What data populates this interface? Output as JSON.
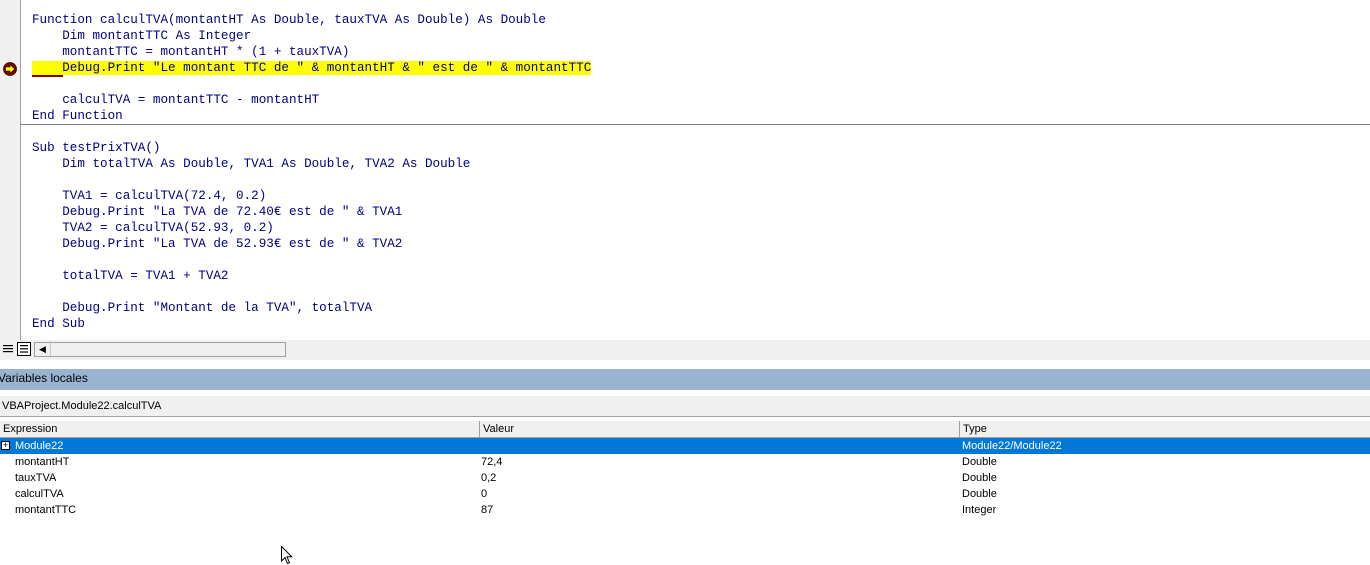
{
  "editor": {
    "lines": [
      "Function calculTVA(montantHT As Double, tauxTVA As Double) As Double",
      "    Dim montantTTC As Integer",
      "    montantTTC = montantHT * (1 + tauxTVA)",
      "    Debug.Print \"Le montant TTC de \" & montantHT & \" est de \" & montantTTC",
      "",
      "    calculTVA = montantTTC - montantHT",
      "End Function",
      "",
      "Sub testPrixTVA()",
      "    Dim totalTVA As Double, TVA1 As Double, TVA2 As Double",
      "",
      "    TVA1 = calculTVA(72.4, 0.2)",
      "    Debug.Print \"La TVA de 72.40€ est de \" & TVA1",
      "    TVA2 = calculTVA(52.93, 0.2)",
      "    Debug.Print \"La TVA de 52.93€ est de \" & TVA2",
      "",
      "    totalTVA = TVA1 + TVA2",
      "",
      "    Debug.Print \"Montant de la TVA\", totalTVA",
      "End Sub"
    ],
    "highlight_color": "#ffff00",
    "keyword_color": "#00007f",
    "breakpoint_color": "#800000"
  },
  "locals": {
    "title": "Variables locales",
    "context": "VBAProject.Module22.calculTVA",
    "columns": [
      "Expression",
      "Valeur",
      "Type"
    ],
    "rows": [
      {
        "expression": "Module22",
        "value": "",
        "type": "Module22/Module22",
        "selected": true,
        "expandable": true
      },
      {
        "expression": "montantHT",
        "value": "72,4",
        "type": "Double"
      },
      {
        "expression": "tauxTVA",
        "value": "0,2",
        "type": "Double"
      },
      {
        "expression": "calculTVA",
        "value": "0",
        "type": "Double"
      },
      {
        "expression": "montantTTC",
        "value": "87",
        "type": "Integer"
      }
    ],
    "selection_color": "#0078d7",
    "title_bar_color": "#99b4d1"
  },
  "icons": {
    "exec_arrow": "current-statement-arrow-icon",
    "procedure_view": "procedure-view-icon",
    "module_view": "full-module-view-icon",
    "scroll_left": "scroll-left-arrow-icon",
    "expand": "expand-plus-icon",
    "cursor": "mouse-cursor-icon"
  }
}
